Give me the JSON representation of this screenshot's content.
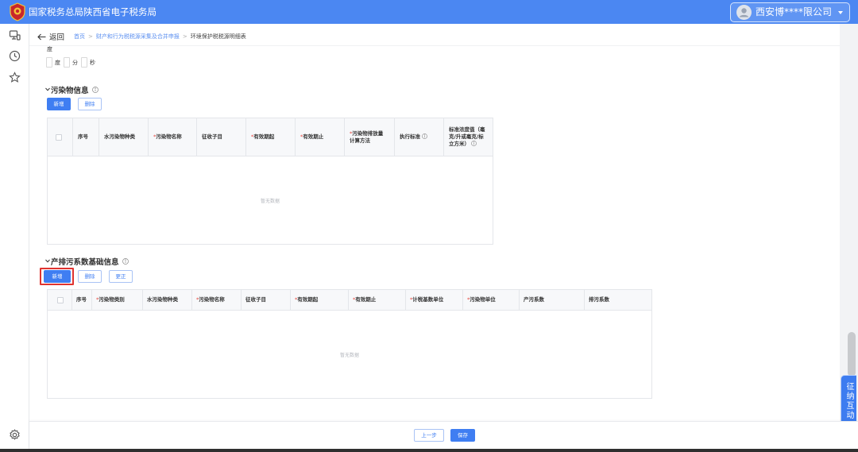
{
  "header": {
    "title": "国家税务总局陕西省电子税务局",
    "user_name": "西安博****限公司",
    "logo_icon": "tax-emblem-logo",
    "avatar_icon": "user-avatar-icon",
    "dropdown_icon": "caret-down-icon"
  },
  "sidebar": {
    "icons": [
      "workbench-icon",
      "clock-icon",
      "star-icon",
      "gear-icon"
    ]
  },
  "breadcrumb": {
    "back_icon": "back-arrow-icon",
    "back_label": "返回",
    "separator": ">",
    "items": [
      "首页",
      "财产和行为税税源采集及合并申报",
      "环境保护税税源明细表"
    ]
  },
  "location_fields": {
    "partial_label": "度",
    "units": [
      "度",
      "分",
      "秒"
    ],
    "values": [
      "",
      "",
      ""
    ]
  },
  "common": {
    "required_mark": "*"
  },
  "pollutant_section": {
    "title": "污染物信息",
    "add_label": "新增",
    "delete_label": "删除",
    "columns": [
      {
        "label": "序号"
      },
      {
        "label": "水污染物种类"
      },
      {
        "label": "污染物名称",
        "required": true
      },
      {
        "label": "征收子目"
      },
      {
        "label": "有效期起",
        "required": true
      },
      {
        "label": "有效期止",
        "required": true
      },
      {
        "label": "污染物排放量计算方法",
        "required": true
      },
      {
        "label": "执行标准",
        "info": true
      },
      {
        "label": "标准浓度值（毫克/升或毫克/标立方米）",
        "info": true
      }
    ],
    "empty_text": "暂无数据"
  },
  "coefficient_section": {
    "title": "产排污系数基础信息",
    "add_label": "新增",
    "delete_label": "删除",
    "correct_label": "更正",
    "columns": [
      {
        "label": "序号"
      },
      {
        "label": "污染物类别",
        "required": true
      },
      {
        "label": "水污染物种类"
      },
      {
        "label": "污染物名称",
        "required": true
      },
      {
        "label": "征收子目"
      },
      {
        "label": "有效期起",
        "required": true
      },
      {
        "label": "有效期止",
        "required": true
      },
      {
        "label": "计税基数单位",
        "required": true
      },
      {
        "label": "污染物单位",
        "required": true
      },
      {
        "label": "产污系数"
      },
      {
        "label": "排污系数"
      }
    ],
    "empty_text": "暂无数据"
  },
  "footer": {
    "prev_label": "上一步",
    "save_label": "保存"
  },
  "floating_widget": {
    "label": "征纳互动"
  },
  "colors": {
    "header_blue": "#4b87f2",
    "primary": "#3f7ef2",
    "required": "#e8453c",
    "highlight": "#e0332f",
    "link": "#5b8ff0"
  }
}
